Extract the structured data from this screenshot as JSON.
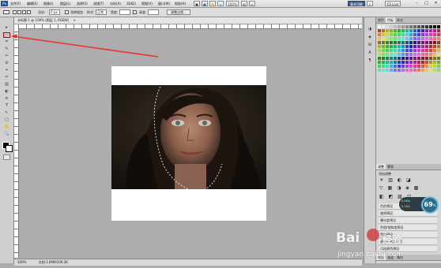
{
  "menubar": {
    "logo": "Ps",
    "menus": [
      "文件(F)",
      "编辑(E)",
      "图像(I)",
      "图层(L)",
      "选择(S)",
      "滤镜(T)",
      "分析(A)",
      "3D(D)",
      "视图(V)",
      "窗口(W)",
      "帮助(H)"
    ],
    "zoom": "100%",
    "workspace_label": "基本功能",
    "cs_live": "CS Live",
    "window_buttons": [
      "–",
      "□",
      "✕"
    ]
  },
  "options": {
    "feather_label": "羽化:",
    "feather_value": "0 px",
    "antialias_label": "消除锯齿",
    "style_label": "样式:",
    "style_value": "正常",
    "width_label": "宽度:",
    "height_label": "高度:",
    "refine_label": "调整边缘..."
  },
  "doc": {
    "tab_label": "未标题-1 @ 100% (图层 1, RGB/8)",
    "status_zoom": "100%",
    "status_doc": "文档:1.09M/200.3K"
  },
  "tools": [
    "▸",
    "◌",
    "⌗",
    "✎",
    "✂",
    "⊘",
    "⌖",
    "✏",
    "▤",
    "◐",
    "≋",
    "T",
    "↖",
    "□",
    "✋",
    "🔍"
  ],
  "dock_icons": [
    "◑",
    "◈",
    "⊞",
    "A",
    "¶"
  ],
  "panels": {
    "top_tabs": [
      "颜色",
      "色板",
      "样式"
    ],
    "adj_tabs": [
      "调整",
      "蒙版"
    ],
    "adj_title": "添加调整",
    "presets": [
      "色阶预设",
      "曲线预设",
      "曝光度预设",
      "色相/饱和度预设",
      "黑白预设",
      "通道混合器预设",
      "可选颜色预设"
    ],
    "layer_tabs": [
      "图层",
      "通道",
      "路径"
    ]
  },
  "badge": {
    "value": "69",
    "unit": "%",
    "up": "0.4K/s",
    "down": "0.1K/s"
  },
  "watermark": {
    "brand": "Bai",
    "brand2": "经验",
    "url": "jingyan.baidu.com"
  },
  "colors": {
    "accent": "#1f4e9c",
    "arrow": "#e8322a",
    "badge": "#2a6c8a"
  }
}
